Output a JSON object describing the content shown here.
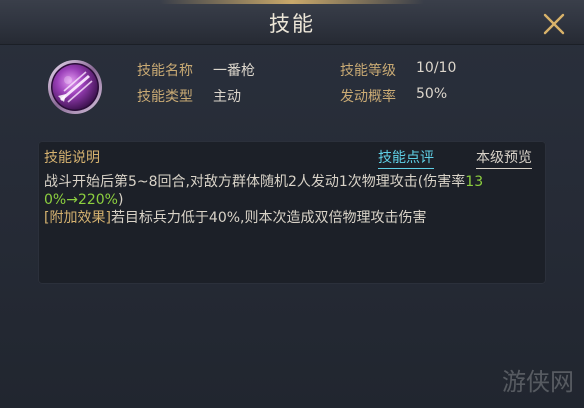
{
  "window": {
    "title": "技能"
  },
  "icons": {
    "close": "close-icon",
    "skill": "skill-icon"
  },
  "skill": {
    "name_label": "技能名称",
    "name_value": "一番枪",
    "level_label": "技能等级",
    "level_value": "10/10",
    "type_label": "技能类型",
    "type_value": "主动",
    "chance_label": "发动概率",
    "chance_value": "50%"
  },
  "description": {
    "header": "技能说明",
    "tab_review": "技能点评",
    "tab_level_preview": "本级预览",
    "line1_text": "战斗开始后第5~8回合,对敌方群体随机2人发动1次物理攻击(伤害率",
    "line1_highlight": "13",
    "line2_highlight": "0%→220%",
    "line2_text": ")",
    "line3_tag": "[附加效果]",
    "line3_text": "若目标兵力低于40%,则本次造成双倍物理攻击伤害"
  },
  "watermark": {
    "text": "游侠网"
  },
  "colors": {
    "label_gold": "#c9aa74",
    "highlight_green": "#8ccf3f",
    "link_cyan": "#5fd0e6",
    "close_gold": "#d8b26a"
  }
}
